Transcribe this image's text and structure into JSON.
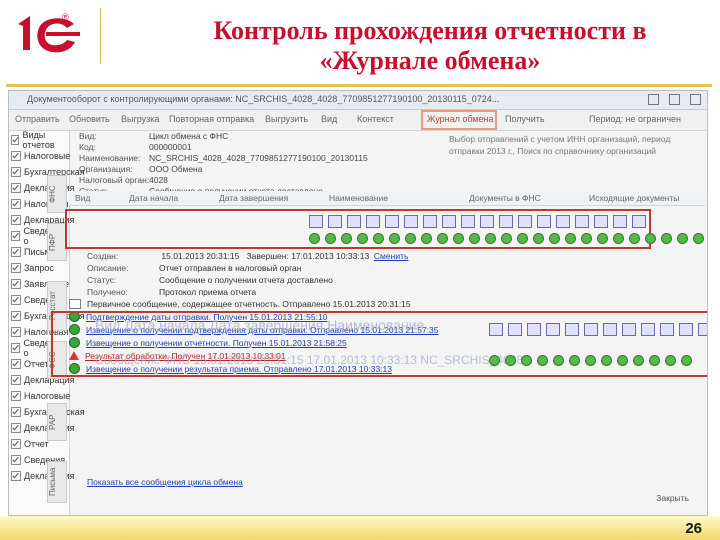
{
  "slide": {
    "title_line1": "Контроль прохождения отчетности в",
    "title_line2": "«Журнале обмена»",
    "page_number": "26",
    "accent": "#c8102e"
  },
  "window": {
    "title": "Документооборот с контролирующими органами: NC_SRCHIS_4028_4028_7709851277190100_20130115_0724...",
    "toolbar": [
      "Отправить",
      "Обновить",
      "Выгрузка",
      "Повторная отправка",
      "Выгрузить",
      "Вид",
      "Контекст",
      "Журнал обмена",
      "Получить",
      "Период: не ограничен"
    ],
    "highlighted_button": "Журнал обмена"
  },
  "left_panel": {
    "rows": [
      "Виды отчетов",
      "Налоговые",
      "Бухгалтерская",
      "Декларация",
      "Налоговая",
      "Декларация",
      "Сведения о",
      "Письма",
      "Запрос",
      "Заявление",
      "Сведения",
      "Бухгалтерская",
      "Налоговая",
      "Сведения о",
      "Отчет",
      "Декларация",
      "Налоговые",
      "Бухгалтерская",
      "Декларация",
      "Отчет",
      "Сведения",
      "Декларация"
    ],
    "tabs": [
      "ФНС",
      "ПФР",
      "Росстат",
      "ФСС",
      "РАР",
      "Письма"
    ]
  },
  "form": {
    "fields": [
      {
        "k": "Вид:",
        "v": "Цикл обмена с ФНС"
      },
      {
        "k": "Код:",
        "v": "000000001"
      },
      {
        "k": "Наименование:",
        "v": "NC_SRCHIS_4028_4028_7709851277190100_20130115"
      },
      {
        "k": "Организация:",
        "v": "ООО Обмена"
      },
      {
        "k": "Налоговый орган:",
        "v": "4028"
      },
      {
        "k": "Статус:",
        "v": "Сообщение о получении отчета доставлено"
      }
    ],
    "right_text": "Выбор отправлений с учетом ИНН организаций, период отправки 2013 г., Поиск по справочнику организаций"
  },
  "grid": {
    "headers": [
      "Вид",
      "Дата начала",
      "Дата завершения",
      "Наименование",
      "Документы в ФНС",
      "Исходящие документы"
    ]
  },
  "info": {
    "lines": [
      {
        "k": "Создан:",
        "v": "15.01.2013 20:31:15",
        "k2": "Завершен:",
        "v2": "17.01.2013 10:33:13",
        "link": "Сменить"
      },
      {
        "k": "Описание:",
        "v": "Отчет отправлен в налоговый орган"
      },
      {
        "k": "Статус:",
        "v": "Сообщение о получении отчета доставлено"
      },
      {
        "k": "Получено:",
        "v": "Протокол приема отчета"
      }
    ]
  },
  "messages": [
    {
      "icon": "envelope",
      "text": "Первичное сообщение, содержащее отчетность. Отправлено 15.01.2013 20:31:15",
      "style": "normal"
    },
    {
      "icon": "ok",
      "text": "Подтверждение даты отправки. Получен 15.01.2013 21:55:10",
      "style": "link"
    },
    {
      "icon": "ok",
      "text": "Извещение о получении подтверждения даты отправки. Отправлено 15.01.2013 21:57:35",
      "style": "link"
    },
    {
      "icon": "ok",
      "text": "Извещение о получении отчетности. Получен 15.01.2013 21:58:25",
      "style": "link"
    },
    {
      "icon": "warn",
      "text": "Результат обработки. Получен 17.01.2013 10:33:01",
      "style": "err"
    },
    {
      "icon": "ok",
      "text": "Извещение о получении результата приема. Отправлено 17.01.2013 10:33:13",
      "style": "link"
    }
  ],
  "ghost": {
    "row_text": "Вид   Дата начала   Дата завершения   Наименование",
    "row_values": "Сообщение ФНС   15.01.2013 20:31:15   17.01.2013 10:33:13   NC_SRCHIS_4028..."
  },
  "bottom": {
    "link": "Показать все сообщения цикла обмена",
    "close": "Закрыть"
  }
}
